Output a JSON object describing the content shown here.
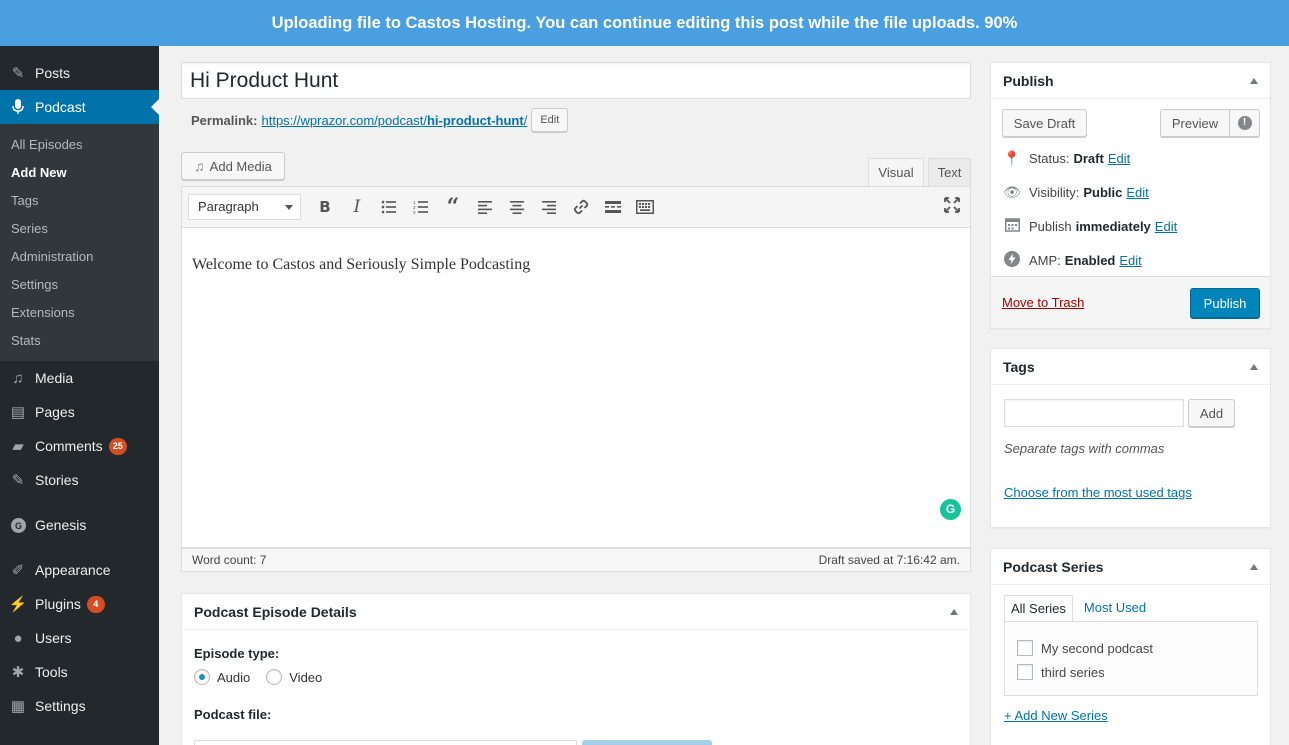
{
  "banner": {
    "message": "Uploading file to Castos Hosting. You can continue editing this post while the file uploads.",
    "percent": "90%"
  },
  "sidebar": {
    "top_items": [
      {
        "label": "Posts",
        "icon": "pin-icon"
      },
      {
        "label": "Podcast",
        "icon": "microphone-icon"
      }
    ],
    "submenu": [
      "All Episodes",
      "Add New",
      "Tags",
      "Series",
      "Administration",
      "Settings",
      "Extensions",
      "Stats"
    ],
    "bottom_items": [
      {
        "label": "Media",
        "icon": "media-icon"
      },
      {
        "label": "Pages",
        "icon": "pages-icon"
      },
      {
        "label": "Comments",
        "icon": "comment-icon",
        "badge": "25"
      },
      {
        "label": "Stories",
        "icon": "pin-icon"
      },
      {
        "label": "Genesis",
        "icon": "genesis-icon"
      },
      {
        "label": "Appearance",
        "icon": "brush-icon"
      },
      {
        "label": "Plugins",
        "icon": "plug-icon",
        "badge": "4"
      },
      {
        "label": "Users",
        "icon": "user-icon"
      },
      {
        "label": "Tools",
        "icon": "wrench-icon"
      },
      {
        "label": "Settings",
        "icon": "sliders-icon"
      }
    ]
  },
  "post": {
    "title": "Hi Product Hunt",
    "permalink_label": "Permalink:",
    "permalink_base": "https://wprazor.com/podcast/",
    "permalink_slug": "hi-product-hunt",
    "permalink_trail": "/",
    "permalink_edit": "Edit"
  },
  "editor": {
    "add_media": "Add Media",
    "tab_visual": "Visual",
    "tab_text": "Text",
    "format": "Paragraph",
    "content": "Welcome to Castos and Seriously Simple Podcasting",
    "word_count": "Word count: 7",
    "draft_saved": "Draft saved at 7:16:42 am.",
    "grammarly": "G"
  },
  "episode": {
    "title": "Podcast Episode Details",
    "type_label": "Episode type:",
    "options": [
      "Audio",
      "Video"
    ],
    "selected": "Audio",
    "file_label": "Podcast file:"
  },
  "publish": {
    "title": "Publish",
    "save_draft": "Save Draft",
    "preview": "Preview",
    "status_label": "Status:",
    "status_value": "Draft",
    "visibility_label": "Visibility:",
    "visibility_value": "Public",
    "publish_label": "Publish",
    "publish_value": "immediately",
    "amp_label": "AMP:",
    "amp_value": "Enabled",
    "edit": "Edit",
    "trash": "Move to Trash",
    "publish_button": "Publish"
  },
  "tags": {
    "title": "Tags",
    "add": "Add",
    "hint": "Separate tags with commas",
    "choose": "Choose from the most used tags"
  },
  "series": {
    "title": "Podcast Series",
    "tab_all": "All Series",
    "tab_most": "Most Used",
    "items": [
      "My second podcast",
      "third series"
    ],
    "add_new": "+ Add New Series"
  },
  "colors": {
    "banner": "#4a9fe0",
    "sidebar": "#23282d",
    "accent": "#0073aa",
    "publish": "#0085ba",
    "badge": "#d54e21"
  }
}
